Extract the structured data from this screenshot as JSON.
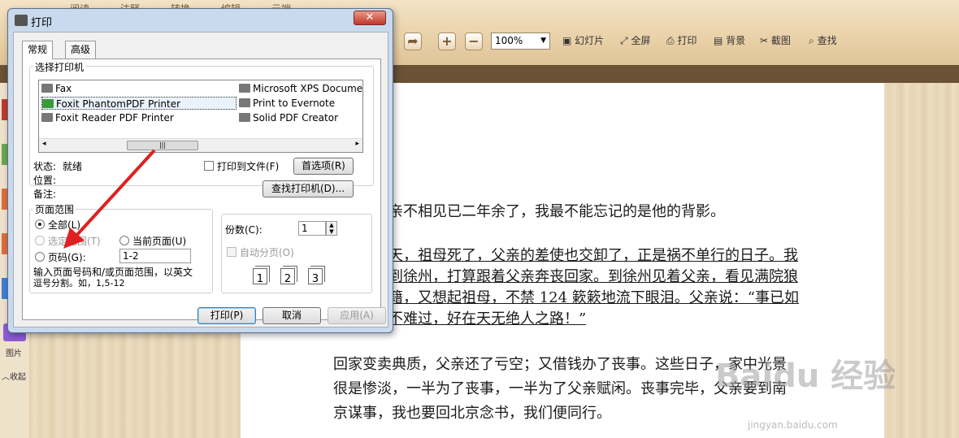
{
  "app": {
    "menu_tabs": [
      "阅读",
      "注释",
      "转换",
      "编辑",
      "云端"
    ],
    "toolbar": {
      "zoom_value": "100%",
      "slideshow": "幻灯片",
      "fullscreen": "全屏",
      "print": "打印",
      "background": "背景",
      "screenshot": "截图",
      "find": "查找"
    },
    "sidebar": {
      "picture_label": "图片",
      "collapse_label": "收起"
    }
  },
  "document": {
    "paragraphs": [
      {
        "text": "亲不相见已二年余了，我最不能忘记的是他的背影。",
        "underline": false
      },
      {
        "text": "天，祖母死了，父亲的差使也交卸了，正是祸不单行的日子。我",
        "underline": true
      },
      {
        "text": "到徐州，打算跟着父亲奔丧回家。到徐州见着父亲，看见满院狼",
        "underline": true
      },
      {
        "text": "籍，又想起祖母，不禁 124 簌簌地流下眼泪。父亲说：“事已如",
        "underline": true
      },
      {
        "text": "不难过，好在天无绝人之路！”",
        "underline": true
      },
      {
        "text": "回家变卖典质，父亲还了亏空；又借钱办了丧事。这些日子，家中光景",
        "underline": false
      },
      {
        "text": "很是惨淡，一半为了丧事，一半为了父亲赋闲。丧事完毕，父亲要到南",
        "underline": false
      },
      {
        "text": "京谋事，我也要回北京念书，我们便同行。",
        "underline": false
      }
    ],
    "watermark": "Baidu 经验",
    "watermark_url": "jingyan.baidu.com"
  },
  "dialog": {
    "title": "打印",
    "close_glyph": "✕",
    "tabs": [
      "常规",
      "高级"
    ],
    "select_printer_label": "选择打印机",
    "printers": [
      {
        "name": "Fax"
      },
      {
        "name": "Microsoft XPS Docume"
      },
      {
        "name": "Foxit PhantomPDF Printer",
        "selected": true
      },
      {
        "name": "Print to Evernote"
      },
      {
        "name": "Foxit Reader PDF Printer"
      },
      {
        "name": "Solid PDF Creator"
      }
    ],
    "status_label": "状态:",
    "status_value": "就绪",
    "location_label": "位置:",
    "comment_label": "备注:",
    "print_to_file": "打印到文件(F)",
    "preferences_button": "首选项(R)",
    "find_printer_button": "查找打印机(D)...",
    "page_range": {
      "label": "页面范围",
      "all": "全部(L)",
      "selection": "选定范围(T)",
      "current_page": "当前页面(U)",
      "pages": "页码(G):",
      "pages_value": "1-2",
      "hint_line1": "输入页面号码和/或页面范围，以英文",
      "hint_line2": "逗号分割。如，1,5-12"
    },
    "copies_label": "份数(C):",
    "copies_value": "1",
    "collate_label": "自动分页(O)",
    "collate_pages": [
      "1",
      "1",
      "2",
      "2",
      "3",
      "3"
    ],
    "print_button": "打印(P)",
    "cancel_button": "取消",
    "apply_button": "应用(A)"
  }
}
